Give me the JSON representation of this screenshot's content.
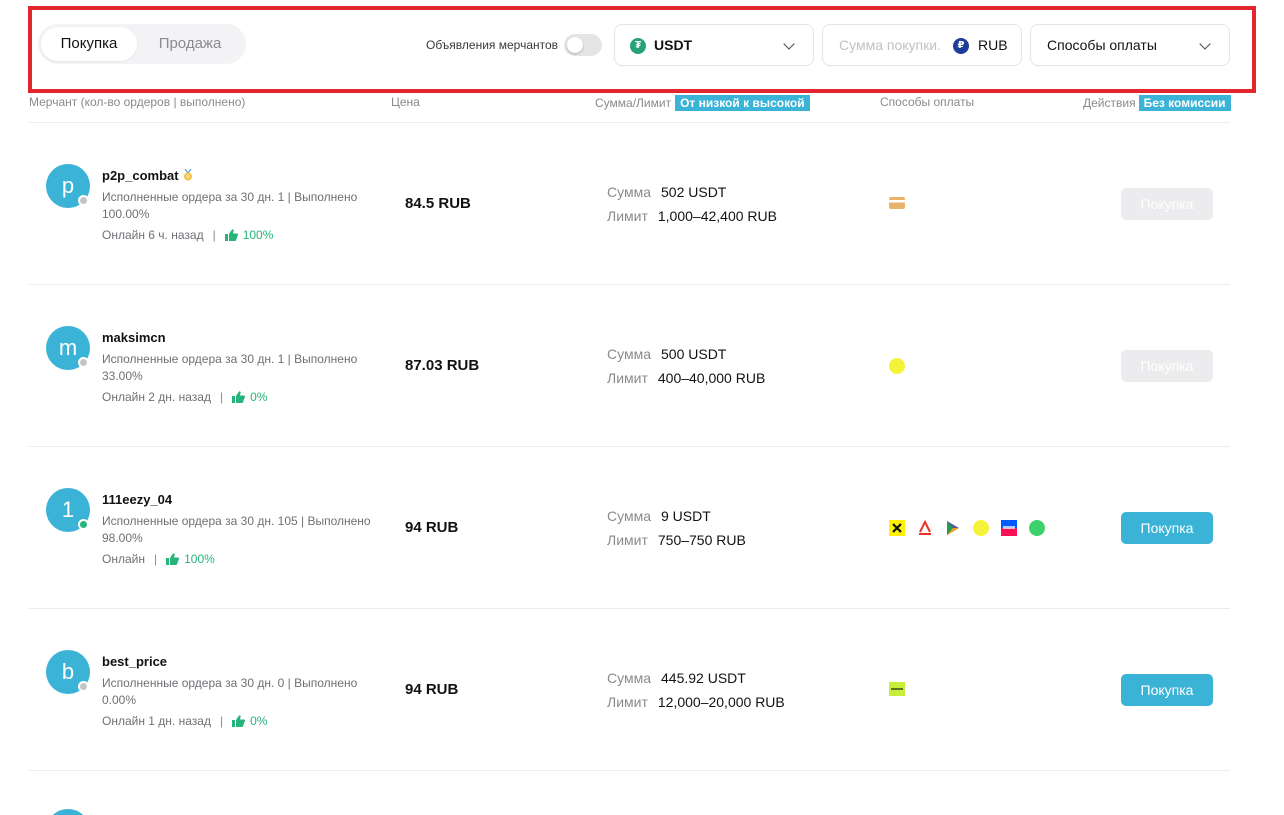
{
  "filter": {
    "tabs": {
      "buy": "Покупка",
      "sell": "Продажа"
    },
    "merchant_ads_label": "Объявления мерчантов",
    "merchant_ads_enabled": false,
    "coin": "USDT",
    "amount_placeholder": "Сумма покупки.",
    "fiat": "RUB",
    "payment_methods_label": "Способы оплаты"
  },
  "header": {
    "merchant": "Мерчант (кол-во ордеров | выполнено)",
    "price": "Цена",
    "amount_limit": "Сумма/Лимит",
    "sort_tag": "От низкой к высокой",
    "payment_methods": "Способы оплаты",
    "actions": "Действия",
    "fee_tag": "Без комиссии"
  },
  "labels": {
    "sum": "Сумма",
    "limit": "Лимит"
  },
  "rows": [
    {
      "initial": "p",
      "name": "p2p_combat",
      "stats": "Исполненные ордера за 30 дн. 1 | Выполнено 100.00%",
      "online": "Онлайн 6 ч. назад",
      "rating": "100%",
      "is_online": false,
      "price": "84.5 RUB",
      "sum": "502 USDT",
      "limit": "1,000–42,400 RUB",
      "methods": [
        "card-icon"
      ],
      "button": "Покупка",
      "button_enabled": false
    },
    {
      "initial": "m",
      "name": "maksimcn",
      "stats": "Исполненные ордера за 30 дн. 1 | Выполнено 33.00%",
      "online": "Онлайн 2 дн. назад",
      "rating": "0%",
      "is_online": false,
      "price": "87.03 RUB",
      "sum": "500 USDT",
      "limit": "400–40,000 RUB",
      "methods": [
        "yellow-dot-icon"
      ],
      "button": "Покупка",
      "button_enabled": false
    },
    {
      "initial": "1",
      "name": "111eezy_04",
      "stats": "Исполненные ордера за 30 дн. 105 | Выполнено 98.00%",
      "online": "Онлайн",
      "rating": "100%",
      "is_online": true,
      "price": "94 RUB",
      "sum": "9 USDT",
      "limit": "750–750 RUB",
      "methods": [
        "raiffeisen-icon",
        "alfa-icon",
        "sbp-icon",
        "yellow-dot-icon",
        "ozon-icon",
        "green-dot-icon"
      ],
      "button": "Покупка",
      "button_enabled": true
    },
    {
      "initial": "b",
      "name": "best_price",
      "stats": "Исполненные ордера за 30 дн. 0 | Выполнено 0.00%",
      "online": "Онлайн 1 дн. назад",
      "rating": "0%",
      "is_online": false,
      "price": "94 RUB",
      "sum": "445.92 USDT",
      "limit": "12,000–20,000 RUB",
      "methods": [
        "green-bank-icon"
      ],
      "button": "Покупка",
      "button_enabled": true
    }
  ],
  "colors": {
    "accent": "#3bb3d6",
    "highlight_border": "#e3262d",
    "online_green": "#27b47a"
  }
}
